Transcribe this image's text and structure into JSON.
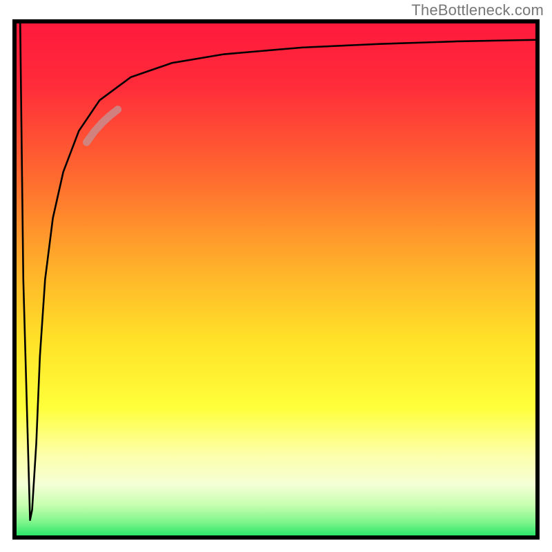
{
  "watermark": "TheBottleneck.com",
  "gradient": {
    "stops": [
      {
        "offset": 0.0,
        "color": "#ff1a3c"
      },
      {
        "offset": 0.12,
        "color": "#ff2b3a"
      },
      {
        "offset": 0.3,
        "color": "#ff6a2f"
      },
      {
        "offset": 0.48,
        "color": "#ffb22a"
      },
      {
        "offset": 0.62,
        "color": "#ffe228"
      },
      {
        "offset": 0.75,
        "color": "#ffff3a"
      },
      {
        "offset": 0.84,
        "color": "#fdffa8"
      },
      {
        "offset": 0.9,
        "color": "#f4ffd6"
      },
      {
        "offset": 0.94,
        "color": "#c8ffb0"
      },
      {
        "offset": 0.975,
        "color": "#7cf58a"
      },
      {
        "offset": 1.0,
        "color": "#2ce66a"
      }
    ]
  },
  "chart_data": {
    "type": "line",
    "title": "",
    "xlabel": "",
    "ylabel": "",
    "xlim": [
      0,
      100
    ],
    "ylim": [
      0,
      100
    ],
    "series": [
      {
        "name": "curve-black",
        "color": "#000000",
        "x": [
          0.7,
          1.3,
          2.6,
          3.0,
          3.8,
          4.5,
          5.5,
          7.0,
          9.0,
          12.0,
          16.0,
          22.0,
          30.0,
          40.0,
          55.0,
          70.0,
          85.0,
          100.0
        ],
        "y": [
          100.0,
          50.0,
          3.0,
          5.0,
          18.0,
          35.0,
          50.0,
          62.0,
          71.0,
          79.0,
          85.0,
          89.5,
          92.3,
          94.0,
          95.3,
          96.0,
          96.5,
          96.8
        ]
      },
      {
        "name": "highlight-segment",
        "color": "#c98c8c",
        "x": [
          13.5,
          15.0,
          16.5,
          18.0,
          19.5
        ],
        "y": [
          76.8,
          78.9,
          80.6,
          82.0,
          83.2
        ]
      }
    ],
    "annotations": []
  }
}
